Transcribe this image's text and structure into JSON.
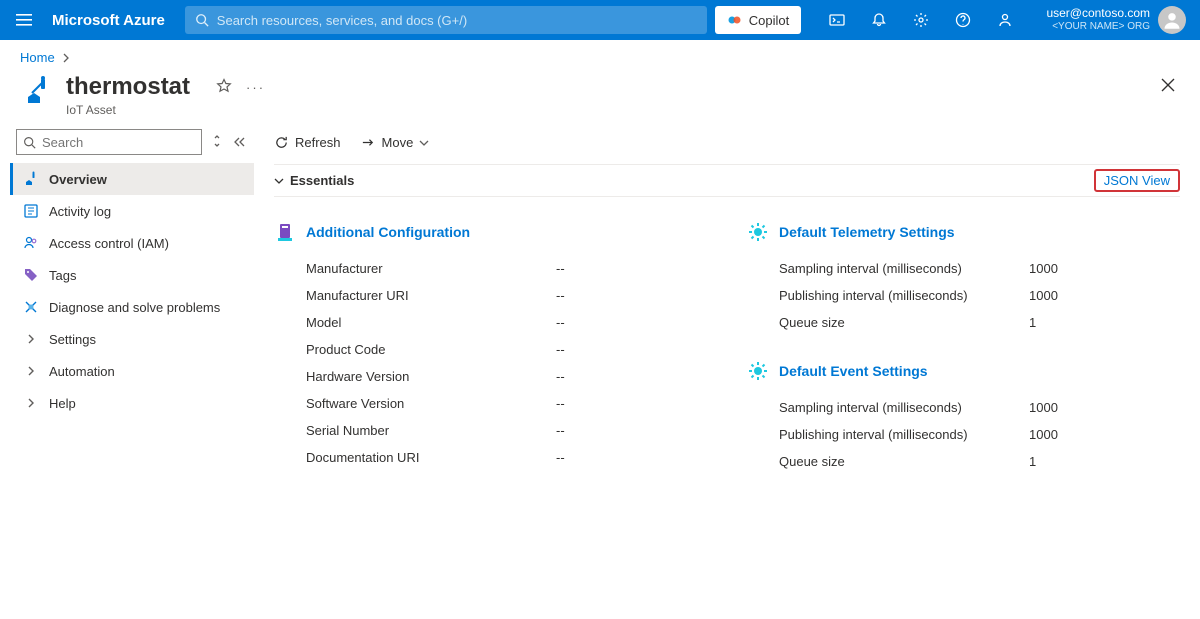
{
  "topbar": {
    "brand": "Microsoft Azure",
    "search_placeholder": "Search resources, services, and docs (G+/)",
    "copilot_label": "Copilot"
  },
  "user": {
    "email": "user@contoso.com",
    "org": "<YOUR NAME> ORG"
  },
  "breadcrumb": {
    "home": "Home"
  },
  "header": {
    "title": "thermostat",
    "subtitle": "IoT Asset"
  },
  "sidebar": {
    "search_placeholder": "Search",
    "items": [
      {
        "label": "Overview"
      },
      {
        "label": "Activity log"
      },
      {
        "label": "Access control (IAM)"
      },
      {
        "label": "Tags"
      },
      {
        "label": "Diagnose and solve problems"
      },
      {
        "label": "Settings"
      },
      {
        "label": "Automation"
      },
      {
        "label": "Help"
      }
    ]
  },
  "toolbar": {
    "refresh": "Refresh",
    "move": "Move"
  },
  "essentials": {
    "label": "Essentials",
    "json_view": "JSON View"
  },
  "sections": {
    "additional_config": {
      "title": "Additional Configuration",
      "rows": [
        {
          "k": "Manufacturer",
          "v": "--"
        },
        {
          "k": "Manufacturer URI",
          "v": "--"
        },
        {
          "k": "Model",
          "v": "--"
        },
        {
          "k": "Product Code",
          "v": "--"
        },
        {
          "k": "Hardware Version",
          "v": "--"
        },
        {
          "k": "Software Version",
          "v": "--"
        },
        {
          "k": "Serial Number",
          "v": "--"
        },
        {
          "k": "Documentation URI",
          "v": "--"
        }
      ]
    },
    "telemetry": {
      "title": "Default Telemetry Settings",
      "rows": [
        {
          "k": "Sampling interval (milliseconds)",
          "v": "1000"
        },
        {
          "k": "Publishing interval (milliseconds)",
          "v": "1000"
        },
        {
          "k": "Queue size",
          "v": "1"
        }
      ]
    },
    "event": {
      "title": "Default Event Settings",
      "rows": [
        {
          "k": "Sampling interval (milliseconds)",
          "v": "1000"
        },
        {
          "k": "Publishing interval (milliseconds)",
          "v": "1000"
        },
        {
          "k": "Queue size",
          "v": "1"
        }
      ]
    }
  }
}
